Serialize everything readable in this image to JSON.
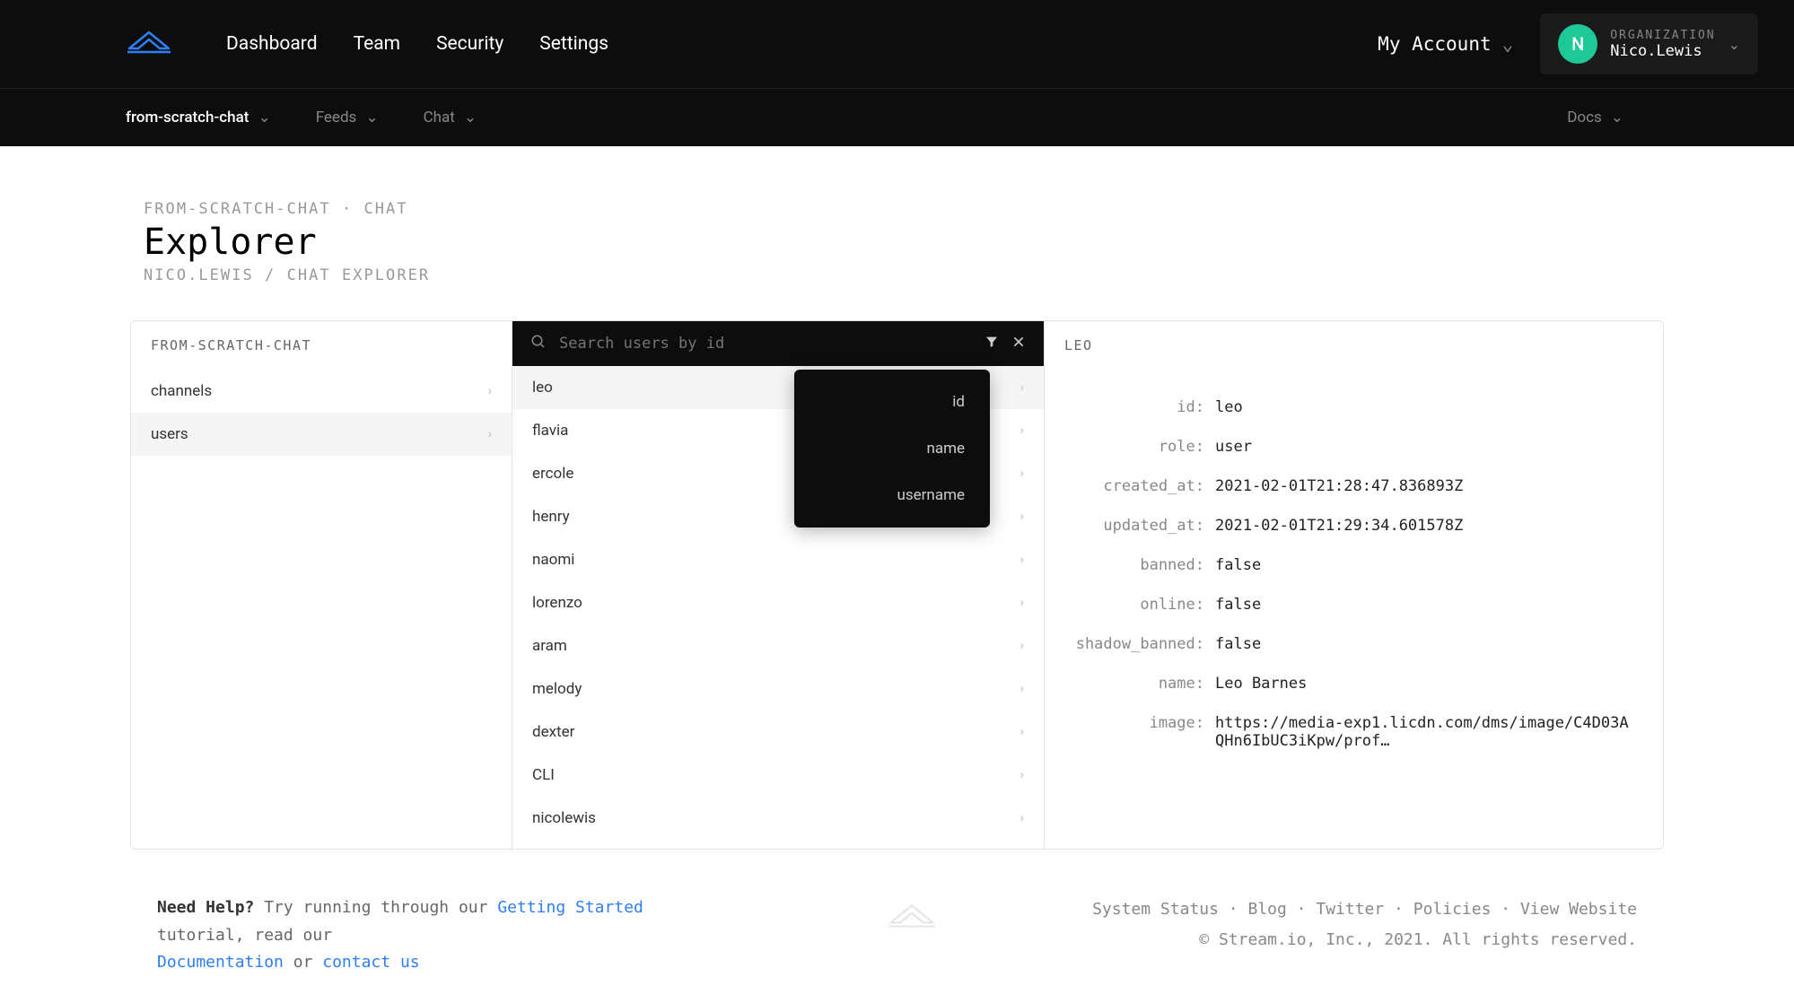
{
  "nav": {
    "links": [
      "Dashboard",
      "Team",
      "Security",
      "Settings"
    ],
    "account": "My Account",
    "org_label": "ORGANIZATION",
    "org_name": "Nico.Lewis",
    "org_initial": "N"
  },
  "subnav": {
    "project": "from-scratch-chat",
    "feeds": "Feeds",
    "chat": "Chat",
    "docs": "Docs"
  },
  "header": {
    "crumb": "FROM-SCRATCH-CHAT · CHAT",
    "title": "Explorer",
    "sub": "NICO.LEWIS / CHAT EXPLORER"
  },
  "col1": {
    "title": "FROM-SCRATCH-CHAT",
    "items": [
      "channels",
      "users"
    ]
  },
  "col2": {
    "search_placeholder": "Search users by id",
    "dropdown": [
      "id",
      "name",
      "username"
    ],
    "users": [
      "leo",
      "flavia",
      "ercole",
      "henry",
      "naomi",
      "lorenzo",
      "aram",
      "melody",
      "dexter",
      "CLI",
      "nicolewis"
    ]
  },
  "col3": {
    "title": "LEO",
    "fields": [
      {
        "k": "id:",
        "v": "leo"
      },
      {
        "k": "role:",
        "v": "user"
      },
      {
        "k": "created_at:",
        "v": "2021-02-01T21:28:47.836893Z"
      },
      {
        "k": "updated_at:",
        "v": "2021-02-01T21:29:34.601578Z"
      },
      {
        "k": "banned:",
        "v": "false"
      },
      {
        "k": "online:",
        "v": "false"
      },
      {
        "k": "shadow_banned:",
        "v": "false"
      },
      {
        "k": "name:",
        "v": "Leo Barnes"
      },
      {
        "k": "image:",
        "v": "https://media-exp1.licdn.com/dms/image/C4D03AQHn6IbUC3iKpw/prof…"
      }
    ]
  },
  "footer": {
    "help_prefix": "Need Help?",
    "help_text1": " Try running through our ",
    "getting_started": "Getting Started",
    "help_text2": " tutorial, read our ",
    "documentation": "Documentation",
    "help_text3": " or ",
    "contact": "contact us",
    "links": [
      "System Status",
      "Blog",
      "Twitter",
      "Policies",
      "View Website"
    ],
    "copyright": "© Stream.io, Inc., 2021. All rights reserved."
  }
}
